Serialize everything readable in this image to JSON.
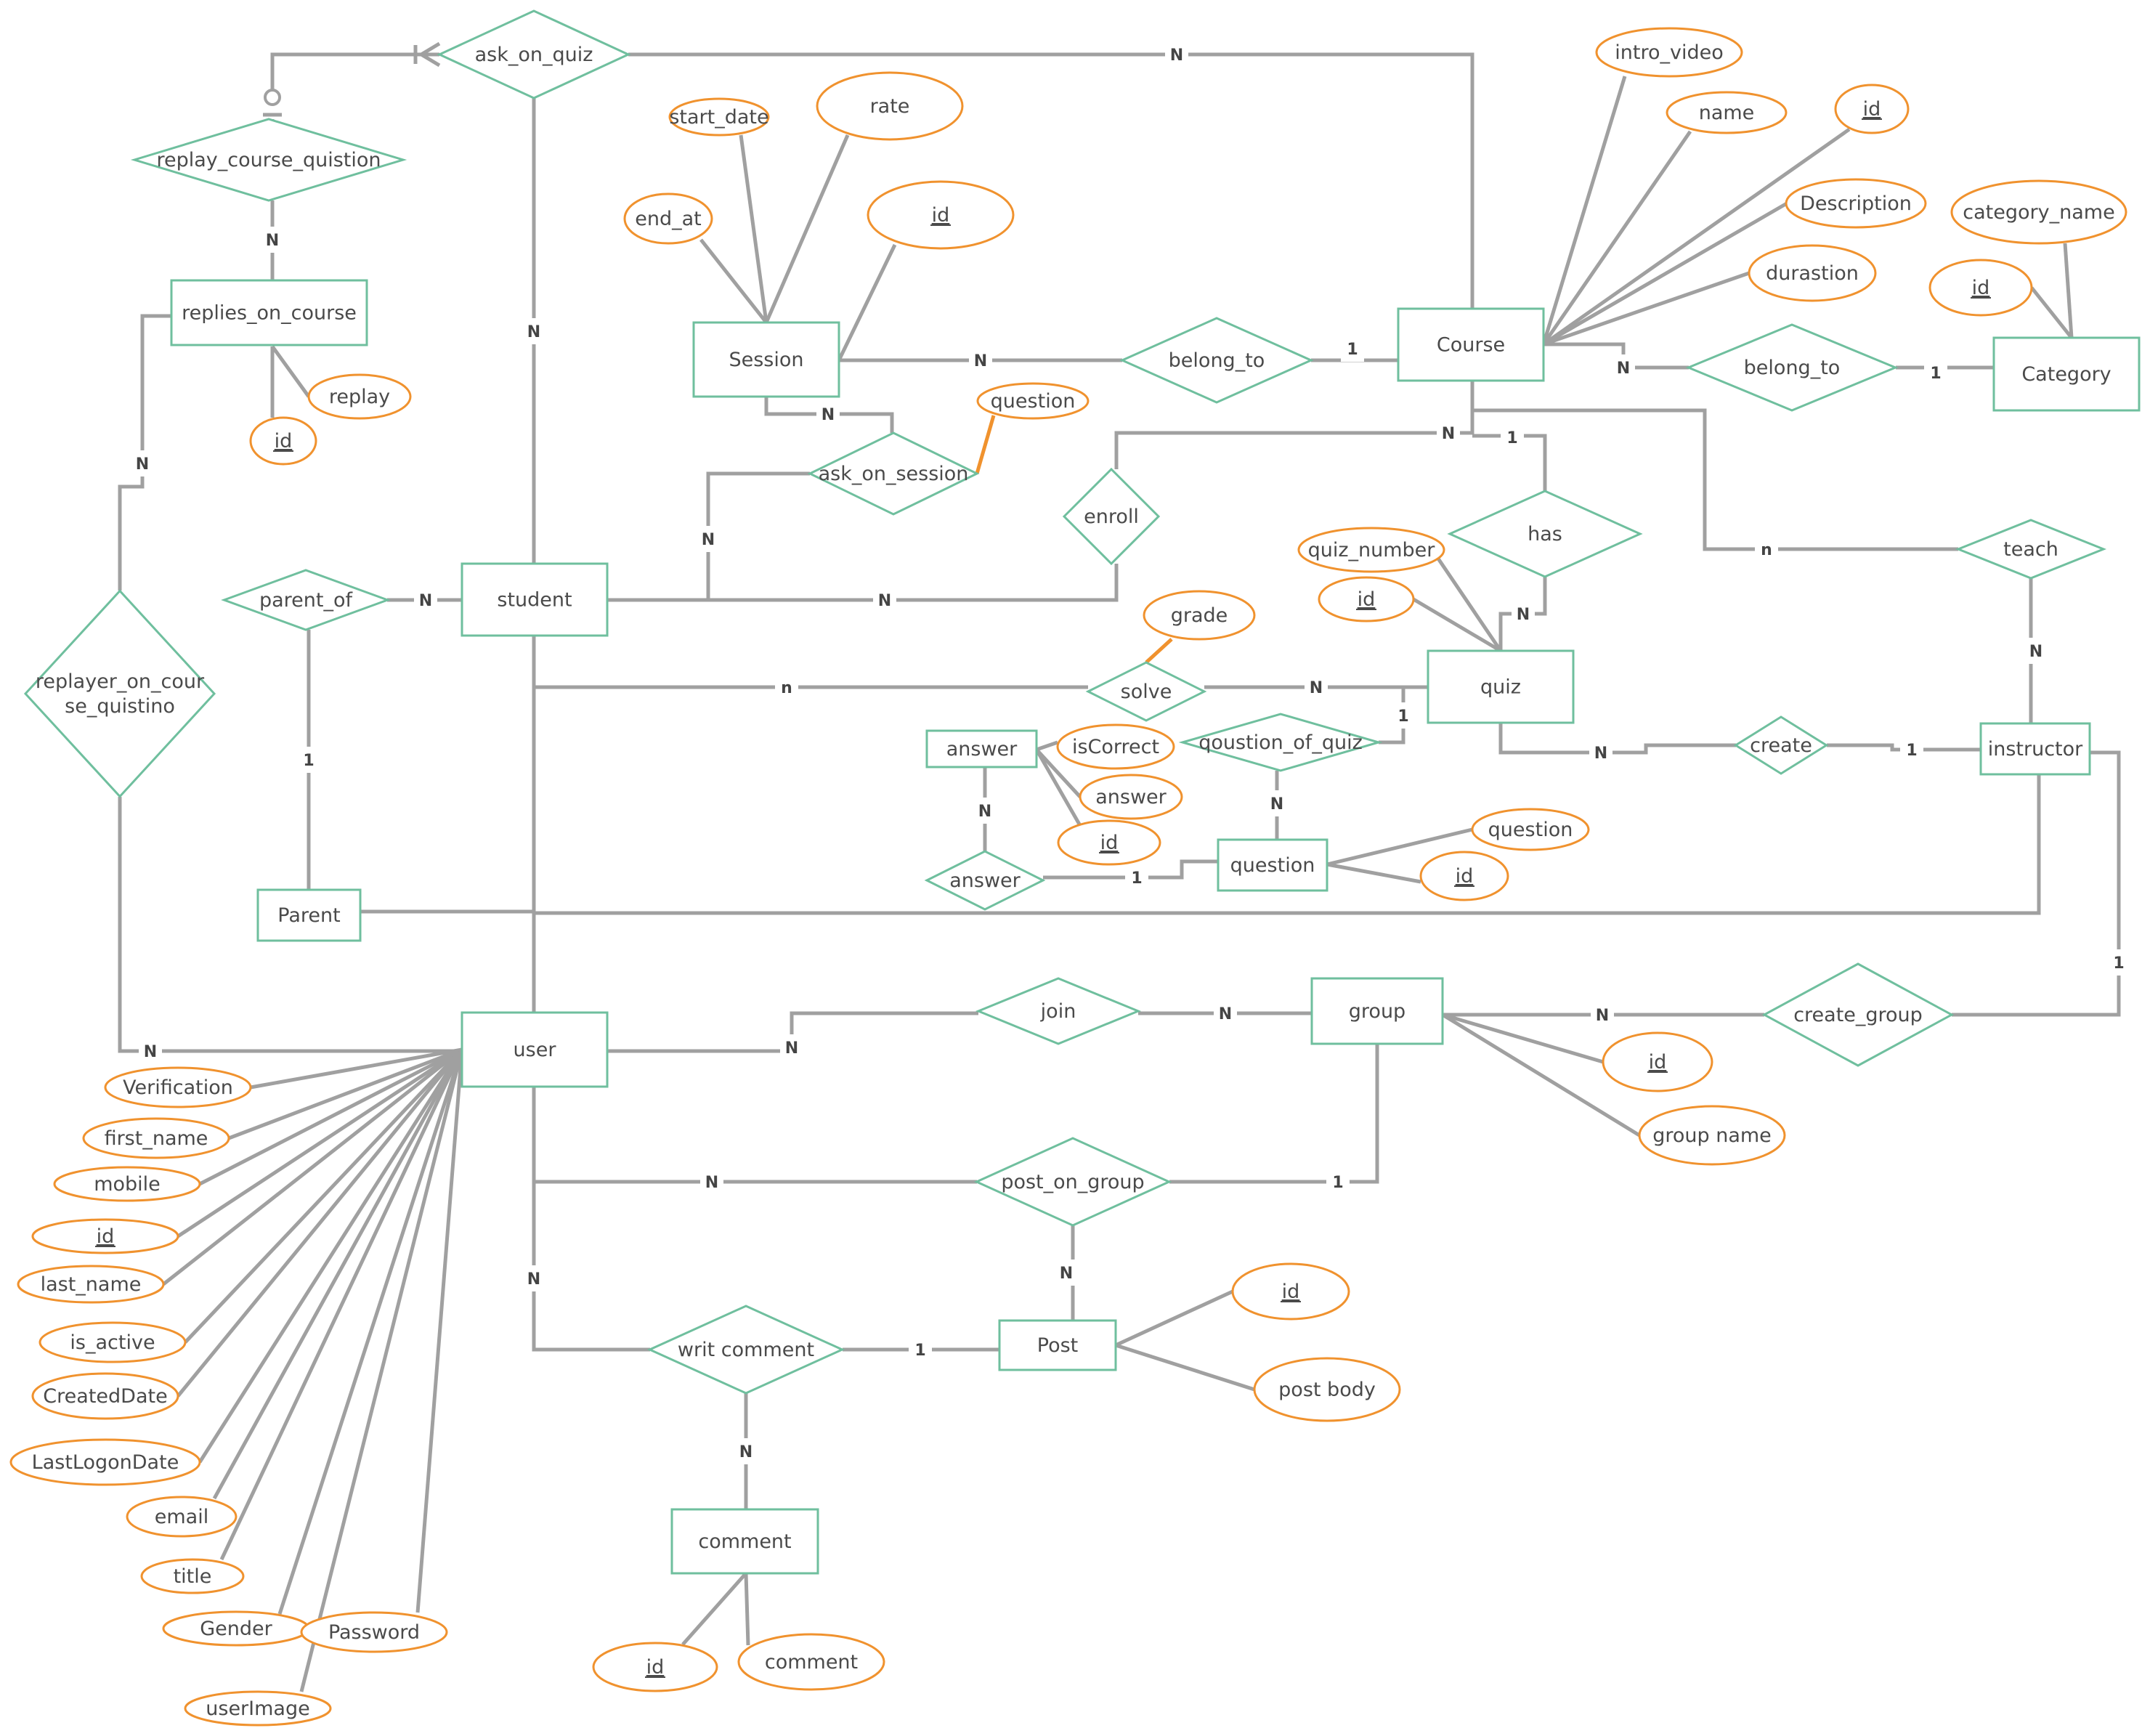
{
  "colors": {
    "entity_border": "#6fbf9e",
    "relationship_border": "#6fbf9e",
    "attribute_border": "#f0922e",
    "connector": "#a0a0a0",
    "text": "#4a4a4a"
  },
  "entities": [
    {
      "id": "replies_on_course",
      "label": "replies_on_course"
    },
    {
      "id": "session",
      "label": "Session"
    },
    {
      "id": "course",
      "label": "Course"
    },
    {
      "id": "category",
      "label": "Category"
    },
    {
      "id": "student",
      "label": "student"
    },
    {
      "id": "parent",
      "label": "Parent"
    },
    {
      "id": "quiz",
      "label": "quiz"
    },
    {
      "id": "answer",
      "label": "answer"
    },
    {
      "id": "question",
      "label": "question"
    },
    {
      "id": "instructor",
      "label": "instructor"
    },
    {
      "id": "user",
      "label": "user"
    },
    {
      "id": "group",
      "label": "group"
    },
    {
      "id": "post",
      "label": "Post"
    },
    {
      "id": "comment",
      "label": "comment"
    }
  ],
  "relationships": [
    {
      "id": "ask_on_quiz",
      "label": "ask_on_quiz"
    },
    {
      "id": "replay_course_quistion",
      "label": "replay_course_quistion"
    },
    {
      "id": "belong_to_session",
      "label": "belong_to"
    },
    {
      "id": "belong_to_category",
      "label": "belong_to"
    },
    {
      "id": "ask_on_session",
      "label": "ask_on_session"
    },
    {
      "id": "enroll",
      "label": "enroll"
    },
    {
      "id": "parent_of",
      "label": "parent_of"
    },
    {
      "id": "replayer_on_course_quistino",
      "label": [
        "replayer_on_cour",
        "se_quistino"
      ]
    },
    {
      "id": "has",
      "label": "has"
    },
    {
      "id": "teach",
      "label": "teach"
    },
    {
      "id": "solve",
      "label": "solve"
    },
    {
      "id": "qoustion_of_quiz",
      "label": "qoustion_of_quiz"
    },
    {
      "id": "answer_rel",
      "label": "answer"
    },
    {
      "id": "create",
      "label": "create"
    },
    {
      "id": "join",
      "label": "join"
    },
    {
      "id": "create_group",
      "label": "create_group"
    },
    {
      "id": "post_on_group",
      "label": "post_on_group"
    },
    {
      "id": "writ_comment",
      "label": "writ comment"
    }
  ],
  "attributes": [
    {
      "owner": "replies_on_course",
      "label": "replay",
      "key": false
    },
    {
      "owner": "replies_on_course",
      "label": "id",
      "key": true
    },
    {
      "owner": "session",
      "label": "start_date",
      "key": false
    },
    {
      "owner": "session",
      "label": "rate",
      "key": false
    },
    {
      "owner": "session",
      "label": "end_at",
      "key": false
    },
    {
      "owner": "session",
      "label": "id",
      "key": true
    },
    {
      "owner": "ask_on_session",
      "label": "question",
      "key": false
    },
    {
      "owner": "course",
      "label": "intro_video",
      "key": false
    },
    {
      "owner": "course",
      "label": "name",
      "key": false
    },
    {
      "owner": "course",
      "label": "id",
      "key": true
    },
    {
      "owner": "course",
      "label": "Description",
      "key": false
    },
    {
      "owner": "course",
      "label": "durastion",
      "key": false
    },
    {
      "owner": "category",
      "label": "category_name",
      "key": false
    },
    {
      "owner": "category",
      "label": "id",
      "key": true
    },
    {
      "owner": "quiz",
      "label": "quiz_number",
      "key": false
    },
    {
      "owner": "quiz",
      "label": "id",
      "key": true
    },
    {
      "owner": "solve",
      "label": "grade",
      "key": false
    },
    {
      "owner": "answer",
      "label": "isCorrect",
      "key": false
    },
    {
      "owner": "answer",
      "label": "answer",
      "key": false
    },
    {
      "owner": "answer",
      "label": "id",
      "key": true
    },
    {
      "owner": "question",
      "label": "question",
      "key": false
    },
    {
      "owner": "question",
      "label": "id",
      "key": true
    },
    {
      "owner": "group",
      "label": "id",
      "key": true
    },
    {
      "owner": "group",
      "label": "group name",
      "key": false
    },
    {
      "owner": "post",
      "label": "id",
      "key": true
    },
    {
      "owner": "post",
      "label": "post body",
      "key": false
    },
    {
      "owner": "comment",
      "label": "id",
      "key": true
    },
    {
      "owner": "comment",
      "label": "comment",
      "key": false
    },
    {
      "owner": "user",
      "label": "Verification",
      "key": false
    },
    {
      "owner": "user",
      "label": "first_name",
      "key": false
    },
    {
      "owner": "user",
      "label": "mobile",
      "key": false
    },
    {
      "owner": "user",
      "label": "id",
      "key": true
    },
    {
      "owner": "user",
      "label": "last_name",
      "key": false
    },
    {
      "owner": "user",
      "label": "is_active",
      "key": false
    },
    {
      "owner": "user",
      "label": "CreatedDate",
      "key": false
    },
    {
      "owner": "user",
      "label": "LastLogonDate",
      "key": false
    },
    {
      "owner": "user",
      "label": "email",
      "key": false
    },
    {
      "owner": "user",
      "label": "title",
      "key": false
    },
    {
      "owner": "user",
      "label": "Gender",
      "key": false
    },
    {
      "owner": "user",
      "label": "Password",
      "key": false
    },
    {
      "owner": "user",
      "label": "userImage",
      "key": false
    }
  ],
  "cardinalities": [
    {
      "rel": "replay_course_quistion",
      "side": "replies_on_course",
      "value": "N"
    },
    {
      "rel": "ask_on_quiz",
      "side": "student",
      "value": "N"
    },
    {
      "rel": "ask_on_quiz",
      "side": "course",
      "value": "N"
    },
    {
      "rel": "replayer_on_course_quistino",
      "side": "replies_on_course",
      "value": "N"
    },
    {
      "rel": "replayer_on_course_quistino",
      "side": "user",
      "value": "N"
    },
    {
      "rel": "belong_to_session",
      "side": "session",
      "value": "N"
    },
    {
      "rel": "belong_to_session",
      "side": "course",
      "value": "1"
    },
    {
      "rel": "belong_to_category",
      "side": "course",
      "value": "N"
    },
    {
      "rel": "belong_to_category",
      "side": "category",
      "value": "1"
    },
    {
      "rel": "ask_on_session",
      "side": "session",
      "value": "N"
    },
    {
      "rel": "ask_on_session",
      "side": "student",
      "value": "N"
    },
    {
      "rel": "enroll",
      "side": "course",
      "value": "N"
    },
    {
      "rel": "enroll",
      "side": "student",
      "value": "N"
    },
    {
      "rel": "has",
      "side": "course",
      "value": "1"
    },
    {
      "rel": "has",
      "side": "quiz",
      "value": "N"
    },
    {
      "rel": "teach",
      "side": "course",
      "value": "n"
    },
    {
      "rel": "teach",
      "side": "instructor",
      "value": "N"
    },
    {
      "rel": "parent_of",
      "side": "student",
      "value": "N"
    },
    {
      "rel": "parent_of",
      "side": "parent",
      "value": "1"
    },
    {
      "rel": "solve",
      "side": "student",
      "value": "n"
    },
    {
      "rel": "solve",
      "side": "quiz",
      "value": "N"
    },
    {
      "rel": "qoustion_of_quiz",
      "side": "quiz",
      "value": "1"
    },
    {
      "rel": "qoustion_of_quiz",
      "side": "question",
      "value": "N"
    },
    {
      "rel": "answer_rel",
      "side": "answer",
      "value": "N"
    },
    {
      "rel": "answer_rel",
      "side": "question",
      "value": "1"
    },
    {
      "rel": "create",
      "side": "quiz",
      "value": "N"
    },
    {
      "rel": "create",
      "side": "instructor",
      "value": "1"
    },
    {
      "rel": "create_group",
      "side": "instructor",
      "value": "1"
    },
    {
      "rel": "create_group",
      "side": "group",
      "value": "N"
    },
    {
      "rel": "join",
      "side": "user",
      "value": "N"
    },
    {
      "rel": "join",
      "side": "group",
      "value": "N"
    },
    {
      "rel": "post_on_group",
      "side": "user",
      "value": "N"
    },
    {
      "rel": "post_on_group",
      "side": "group",
      "value": "1"
    },
    {
      "rel": "post_on_group",
      "side": "post",
      "value": "N"
    },
    {
      "rel": "writ_comment",
      "side": "user",
      "value": "N"
    },
    {
      "rel": "writ_comment",
      "side": "post",
      "value": "1"
    },
    {
      "rel": "writ_comment",
      "side": "comment",
      "value": "N"
    }
  ]
}
